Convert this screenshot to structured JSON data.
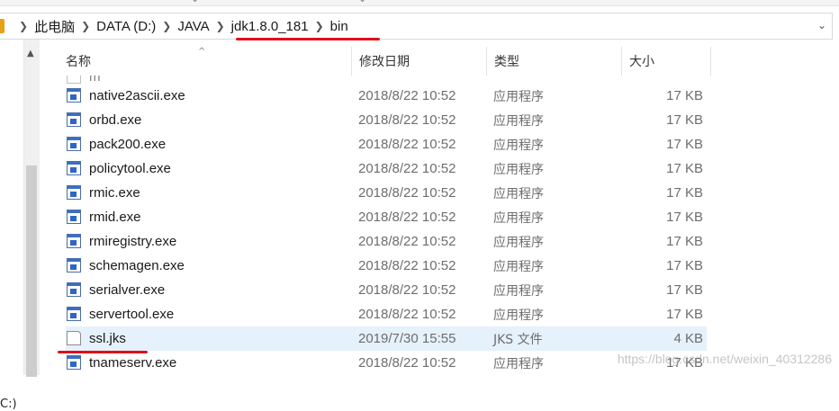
{
  "address_bar": {
    "crumbs": [
      "此电脑",
      "DATA (D:)",
      "JAVA",
      "jdk1.8.0_181",
      "bin"
    ]
  },
  "columns": {
    "name": "名称",
    "date": "修改日期",
    "type": "类型",
    "size": "大小"
  },
  "nav": {
    "drive_label": "C:)"
  },
  "files": [
    {
      "name": "native2ascii.exe",
      "date": "2018/8/22 10:52",
      "type": "应用程序",
      "size": "17 KB",
      "icon": "exe-icon"
    },
    {
      "name": "orbd.exe",
      "date": "2018/8/22 10:52",
      "type": "应用程序",
      "size": "17 KB",
      "icon": "exe-icon"
    },
    {
      "name": "pack200.exe",
      "date": "2018/8/22 10:52",
      "type": "应用程序",
      "size": "17 KB",
      "icon": "exe-icon"
    },
    {
      "name": "policytool.exe",
      "date": "2018/8/22 10:52",
      "type": "应用程序",
      "size": "17 KB",
      "icon": "exe-icon"
    },
    {
      "name": "rmic.exe",
      "date": "2018/8/22 10:52",
      "type": "应用程序",
      "size": "17 KB",
      "icon": "exe-icon"
    },
    {
      "name": "rmid.exe",
      "date": "2018/8/22 10:52",
      "type": "应用程序",
      "size": "17 KB",
      "icon": "exe-icon"
    },
    {
      "name": "rmiregistry.exe",
      "date": "2018/8/22 10:52",
      "type": "应用程序",
      "size": "17 KB",
      "icon": "exe-icon"
    },
    {
      "name": "schemagen.exe",
      "date": "2018/8/22 10:52",
      "type": "应用程序",
      "size": "17 KB",
      "icon": "exe-icon"
    },
    {
      "name": "serialver.exe",
      "date": "2018/8/22 10:52",
      "type": "应用程序",
      "size": "17 KB",
      "icon": "exe-icon"
    },
    {
      "name": "servertool.exe",
      "date": "2018/8/22 10:52",
      "type": "应用程序",
      "size": "17 KB",
      "icon": "exe-icon"
    },
    {
      "name": "ssl.jks",
      "date": "2019/7/30 15:55",
      "type": "JKS 文件",
      "size": "4 KB",
      "icon": "file-icon",
      "selected": true
    },
    {
      "name": "tnameserv.exe",
      "date": "2018/8/22 10:52",
      "type": "应用程序",
      "size": "17 KB",
      "icon": "exe-icon"
    }
  ],
  "watermark": "https://blog.csdn.net/weixin_40312286",
  "colors": {
    "annotation_red": "#e0101a",
    "selection_blue": "#e5f1fb"
  }
}
